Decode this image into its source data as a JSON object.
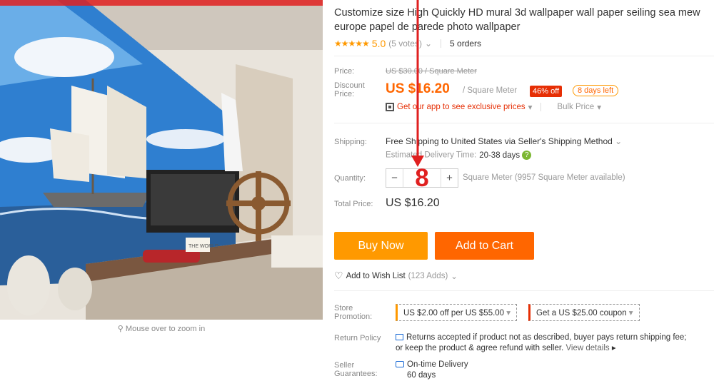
{
  "product": {
    "title": "Customize size High Quickly HD mural 3d wallpaper wall paper seiling sea mew europe papel de parede photo wallpaper",
    "rating": "5.0",
    "votes": "(5 votes)",
    "orders": "5 orders"
  },
  "gallery": {
    "zoom_hint": "Mouse over to zoom in",
    "wall_sign": "THE WORLD"
  },
  "pricing": {
    "price_label": "Price:",
    "original_price": "US $30.00 / Square Meter",
    "discount_label_1": "Discount",
    "discount_label_2": "Price:",
    "discount_price": "US $16.20",
    "unit": "/ Square Meter",
    "off_badge": "46% off",
    "days_left": "8 days left",
    "app_promo": "Get our app to see exclusive prices",
    "bulk_price": "Bulk Price"
  },
  "shipping": {
    "label": "Shipping:",
    "method": "Free Shipping to United States via Seller's Shipping Method",
    "delivery_label": "Estimated Delivery Time:",
    "delivery_time": "20-38 days"
  },
  "quantity": {
    "label": "Quantity:",
    "value": "8",
    "minus": "−",
    "plus": "+",
    "available": "Square Meter (9957 Square Meter available)"
  },
  "total": {
    "label": "Total Price:",
    "value": "US $16.20"
  },
  "actions": {
    "buy_now": "Buy Now",
    "add_to_cart": "Add to Cart",
    "wish_list": "Add to Wish List",
    "wish_count": "(123 Adds)"
  },
  "promotion": {
    "label_1": "Store",
    "label_2": "Promotion:",
    "coupon_1": "US $2.00 off per US $55.00",
    "coupon_2": "Get a US $25.00 coupon"
  },
  "return_policy": {
    "label": "Return Policy",
    "text_1": "Returns accepted if product not as described, buyer pays return shipping fee;",
    "text_2": "or keep the product & agree refund with seller.",
    "view_details": "View details"
  },
  "seller_guarantees": {
    "label_1": "Seller",
    "label_2": "Guarantees:",
    "line_1": "On-time Delivery",
    "line_2": "60 days"
  },
  "colors": {
    "accent_orange": "#ff6600",
    "buy_orange": "#ff9900",
    "annotation_red": "#e02020"
  }
}
